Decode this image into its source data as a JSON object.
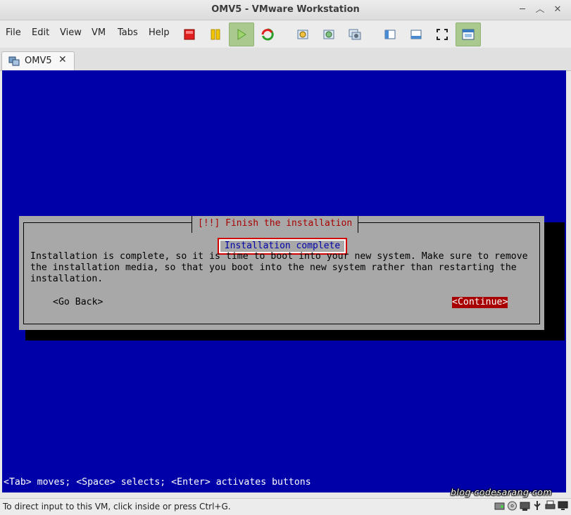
{
  "window": {
    "title": "OMV5 - VMware Workstation"
  },
  "menu": {
    "file": "File",
    "edit": "Edit",
    "view": "View",
    "vm": "VM",
    "tabs": "Tabs",
    "help": "Help"
  },
  "tab": {
    "label": "OMV5",
    "close": "✕"
  },
  "installer": {
    "dialog_title": "[!!] Finish the installation",
    "notice": "Installation complete",
    "body_line1": "Installation is complete, so it is time to boot into your new system. Make sure to remove",
    "body_line2": "the installation media, so that you boot into the new system rather than restarting the",
    "body_line3": "installation.",
    "go_back": "<Go Back>",
    "continue": "<Continue>",
    "footer_hint": "<Tab> moves; <Space> selects; <Enter> activates buttons"
  },
  "watermark": "blog·codesarang·com",
  "status": {
    "message": "To direct input to this VM, click inside or press Ctrl+G."
  },
  "colors": {
    "console_blue": "#0000a8",
    "dialog_gray": "#a8a8a8",
    "dialog_red": "#a80000",
    "highlight": "#d30000"
  }
}
